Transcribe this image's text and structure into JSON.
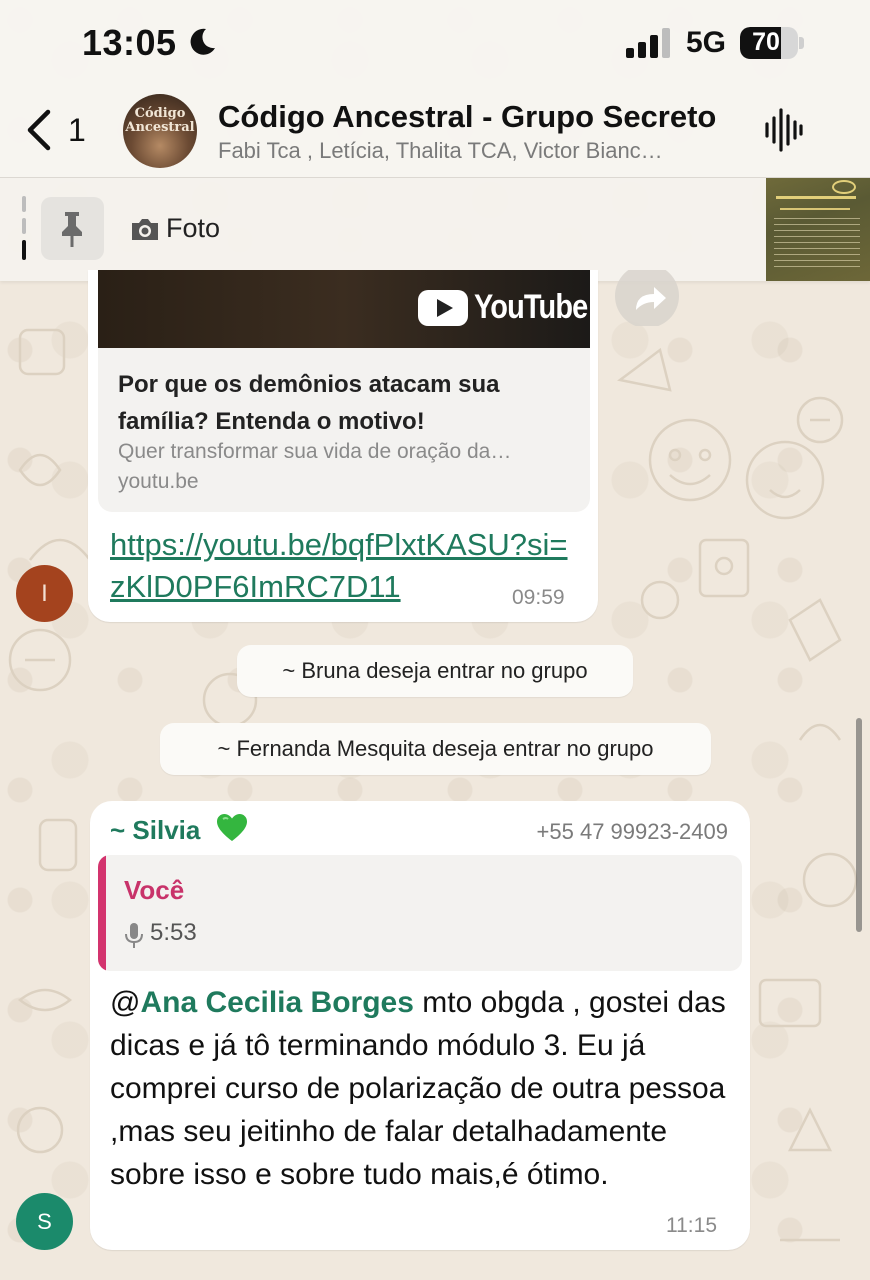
{
  "status_bar": {
    "time": "13:05",
    "network": "5G",
    "battery": "70",
    "battery_level": 0.7,
    "icons": [
      "moon-icon",
      "signal-icon",
      "battery-icon"
    ]
  },
  "header": {
    "back_count": "1",
    "title": "Código Ancestral - Grupo Secreto",
    "subtitle": "Fabi Tca , Letícia, Thalita TCA, Victor Bianc…",
    "avatar_text_1": "Código",
    "avatar_text_2": "Ancestral",
    "icons": [
      "back-chevron-icon",
      "audio-wave-icon"
    ]
  },
  "pinned": {
    "label": "Foto",
    "icons": [
      "pin-icon",
      "camera-icon"
    ]
  },
  "messages": [
    {
      "type": "link",
      "yt_brand": "YouTube",
      "link_title": "Por que os demônios atacam sua família? Entenda o motivo!",
      "link_desc": "Quer transformar sua vida de oração da…",
      "link_domain": "youtu.be",
      "url": "https://youtu.be/bqfPlxtKASU?si=zKlD0PF6ImRC7D11",
      "time": "09:59",
      "avatar_letter": "I"
    },
    {
      "type": "system",
      "text": "~ Bruna deseja entrar no grupo"
    },
    {
      "type": "system",
      "text": "~ Fernanda Mesquita deseja entrar no grupo"
    },
    {
      "type": "text",
      "sender": "~ Silvia",
      "sender_phone": "+55 47 99923-2409",
      "quote_name": "Você",
      "quote_duration": "5:53",
      "mention_prefix": "@",
      "mention": "Ana Cecilia Borges",
      "body": " mto obgda , gostei das dicas e já tô terminando módulo 3. Eu já comprei curso de polarização de outra pessoa ,mas seu jeitinho de falar detalhadamente sobre isso e sobre tudo mais,é ótimo.",
      "time": "11:15",
      "avatar_letter": "S"
    }
  ],
  "colors": {
    "link_green": "#1f7a5d",
    "quote_pink": "#c8336a",
    "avatar_i": "#a4431e",
    "avatar_s": "#1b8a6b"
  }
}
